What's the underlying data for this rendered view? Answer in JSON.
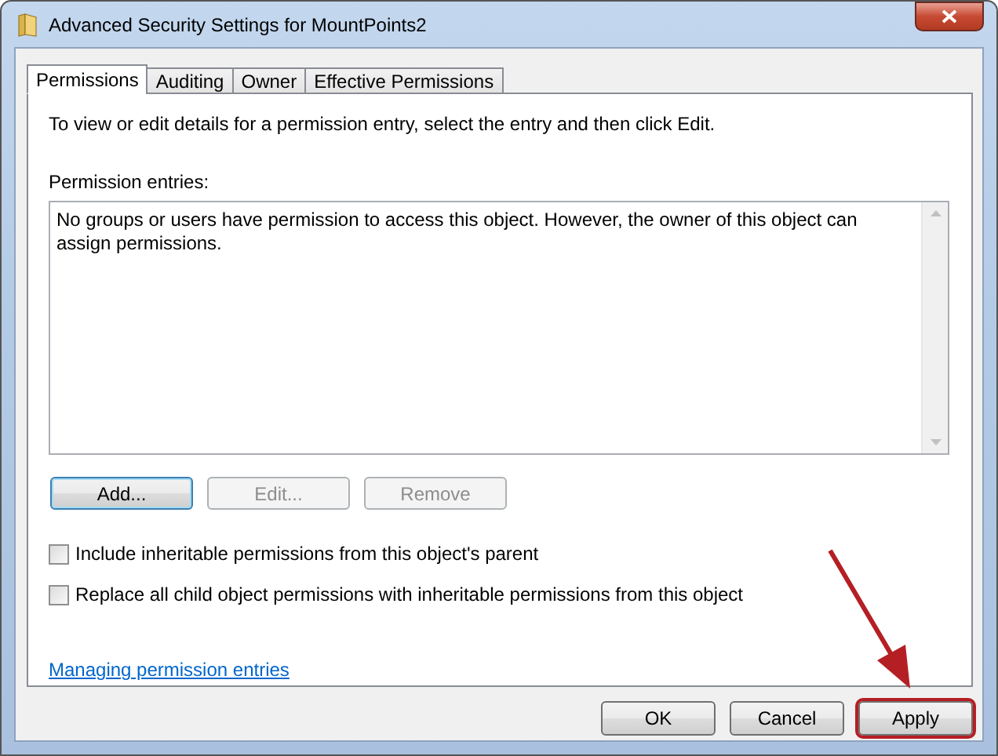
{
  "window": {
    "title": "Advanced Security Settings for MountPoints2"
  },
  "tabs": [
    {
      "label": "Permissions",
      "selected": true
    },
    {
      "label": "Auditing",
      "selected": false
    },
    {
      "label": "Owner",
      "selected": false
    },
    {
      "label": "Effective Permissions",
      "selected": false
    }
  ],
  "instructions": "To view or edit details for a permission entry, select the entry and then click Edit.",
  "entries_label": "Permission entries:",
  "entries_message": "No groups or users have permission to access this object. However, the owner of this object can assign permissions.",
  "entry_buttons": [
    {
      "label": "Add...",
      "disabled": false,
      "default": true
    },
    {
      "label": "Edit...",
      "disabled": true,
      "default": false
    },
    {
      "label": "Remove",
      "disabled": true,
      "default": false
    }
  ],
  "checkboxes": [
    {
      "label": "Include inheritable permissions from this object's parent",
      "checked": false
    },
    {
      "label": "Replace all child object permissions with inheritable permissions from this object",
      "checked": false
    }
  ],
  "link": "Managing permission entries",
  "buttons": [
    {
      "label": "OK",
      "highlighted": false
    },
    {
      "label": "Cancel",
      "highlighted": false
    },
    {
      "label": "Apply",
      "highlighted": true
    }
  ]
}
